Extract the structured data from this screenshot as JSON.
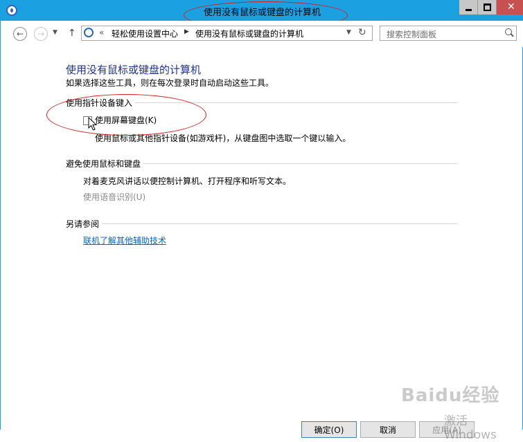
{
  "window": {
    "title": "使用没有鼠标或键盘的计算机",
    "icon": "ease-of-access-icon"
  },
  "nav": {
    "address": {
      "overflow": "«",
      "crumbs": [
        "轻松使用设置中心",
        "使用没有鼠标或键盘的计算机"
      ]
    },
    "search_placeholder": "搜索控制面板"
  },
  "main": {
    "heading": "使用没有鼠标或键盘的计算机",
    "subtitle": "如果选择这些工具，则在每次登录时自动启动这些工具。",
    "section1": {
      "title": "使用指针设备键入",
      "checkbox_label": "使用屏幕键盘(K)",
      "checkbox_checked": false,
      "description": "使用鼠标或其他指针设备(如游戏杆)，从键盘图中选取一个键以输入。"
    },
    "section2": {
      "title": "避免使用鼠标和键盘",
      "description": "对着麦克风讲话以便控制计算机、打开程序和听写文本。",
      "link_disabled": "使用语音识别(U)"
    },
    "section3": {
      "title": "另请参阅",
      "link": "联机了解其他辅助技术"
    }
  },
  "footer": {
    "ok": "确定(O)",
    "cancel": "取消",
    "apply": "应用(A)"
  },
  "watermark": {
    "brand": "Baidu经验",
    "activate": "激活 Windows"
  },
  "colors": {
    "titlebar": "#1ba1e2",
    "heading": "#1e3287",
    "link": "#0066cc",
    "annotation": "#d51e1e"
  }
}
